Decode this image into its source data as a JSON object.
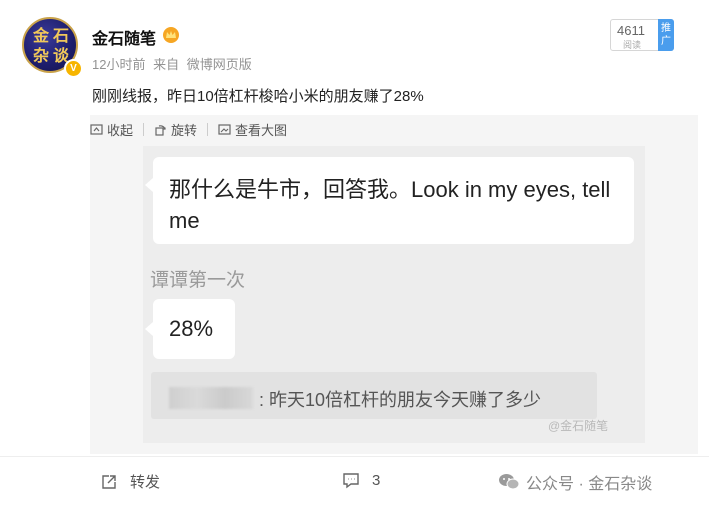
{
  "user": {
    "name": "金石随笔",
    "avatar_chars": [
      "金",
      "石",
      "杂",
      "谈"
    ],
    "time": "12小时前",
    "source_prefix": "来自",
    "source": "微博网页版"
  },
  "reads": {
    "count": "4611",
    "label": "阅读",
    "tag": "推广"
  },
  "post": {
    "text": "刚刚线报，昨日10倍杠杆梭哈小米的朋友赚了28%"
  },
  "toolbar": {
    "collapse": "收起",
    "rotate": "旋转",
    "view_large": "查看大图"
  },
  "image": {
    "bubble1": "那什么是牛市，回答我。Look in my eyes, tell me",
    "sender2": "谭谭第一次",
    "bubble2": "28%",
    "quote": ": 昨天10倍杠杆的朋友今天赚了多少",
    "watermark": "@金石随笔"
  },
  "footer": {
    "repost": "转发",
    "comments": "3",
    "wechat": "公众号 · 金石杂谈"
  },
  "colors": {
    "accent": "#4a9ded",
    "verified": "#f7b500"
  }
}
